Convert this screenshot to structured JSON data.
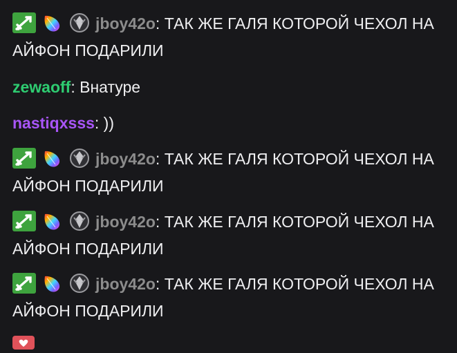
{
  "colors": {
    "background": "#18181b",
    "text": "#efeff1",
    "user_jboy": "#8c8c8c",
    "user_zewaoff": "#2ecc71",
    "user_nastiq": "#a855f7",
    "moderator_badge": "#3ea33e"
  },
  "messages": [
    {
      "badges": [
        "moderator-sword-icon",
        "rainbow-feather-icon",
        "rank-emblem-icon"
      ],
      "user": "jboy42o",
      "colon": ":",
      "text": " ТАК ЖЕ ГАЛЯ КОТОРОЙ ЧЕХОЛ НА АЙФОН ПОДАРИЛИ"
    },
    {
      "badges": [],
      "user": "zewaoff",
      "colon": ":",
      "text": " Внатуре"
    },
    {
      "badges": [],
      "user": "nastiqxsss",
      "colon": ":",
      "text": " ))"
    },
    {
      "badges": [
        "moderator-sword-icon",
        "rainbow-feather-icon",
        "rank-emblem-icon"
      ],
      "user": "jboy42o",
      "colon": ":",
      "text": " ТАК ЖЕ ГАЛЯ КОТОРОЙ ЧЕХОЛ НА АЙФОН ПОДАРИЛИ"
    },
    {
      "badges": [
        "moderator-sword-icon",
        "rainbow-feather-icon",
        "rank-emblem-icon"
      ],
      "user": "jboy42o",
      "colon": ":",
      "text": " ТАК ЖЕ ГАЛЯ КОТОРОЙ ЧЕХОЛ НА АЙФОН ПОДАРИЛИ"
    },
    {
      "badges": [
        "moderator-sword-icon",
        "rainbow-feather-icon",
        "rank-emblem-icon"
      ],
      "user": "jboy42o",
      "colon": ":",
      "text": " ТАК ЖЕ ГАЛЯ КОТОРОЙ ЧЕХОЛ НА АЙФОН ПОДАРИЛИ"
    }
  ]
}
